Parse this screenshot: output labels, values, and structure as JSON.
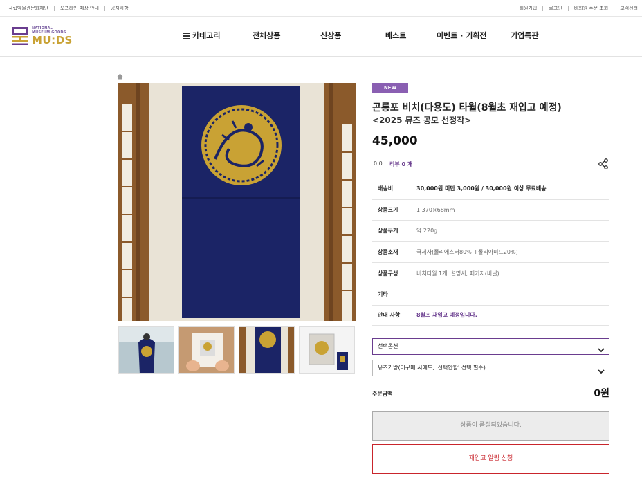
{
  "util_left": [
    "국립박물관문화재단",
    "오프라인 매장 안내",
    "공지사항"
  ],
  "util_right": [
    "회원가입",
    "로그인",
    "비회원 주문 조회",
    "고객센터"
  ],
  "logo": {
    "small_lines": [
      "NATIONAL",
      "MUSEUM GOODS"
    ],
    "big": "MU:DS"
  },
  "nav": [
    "카테고리",
    "전체상품",
    "신상품",
    "베스트",
    "이벤트 · 기획전",
    "기업특판"
  ],
  "product": {
    "badge": "NEW",
    "title": "곤룡포 비치(다용도) 타월(8월초 재입고 예정)",
    "subtitle": "<2025 뮤즈 공모 선정작>",
    "price": "45,000",
    "rating": "0.0",
    "review": "리뷰 0 개"
  },
  "info_rows": [
    {
      "key": "배송비",
      "value": "30,000원 미만 3,000원 / 30,000원 이상 무료배송",
      "style": "bold"
    },
    {
      "key": "상품크기",
      "value": "1,370×68mm",
      "style": ""
    },
    {
      "key": "상품무게",
      "value": "약 220g",
      "style": ""
    },
    {
      "key": "상품소재",
      "value": "극세사(폴리에스터80% +폴리아미드20%)",
      "style": ""
    },
    {
      "key": "상품구성",
      "value": "비치타월 1개, 설명서, 패키지(비닐)",
      "style": ""
    },
    {
      "key": "기타",
      "value": "",
      "style": ""
    },
    {
      "key": "안내 사항",
      "value": "8월초 재입고 예정입니다.",
      "style": "accent"
    }
  ],
  "select1": "선택옵션",
  "select2": "뮤즈가방(미구매 시에도, '선택안함' 선택 필수)",
  "total": {
    "label": "주문금액",
    "value": "0원"
  },
  "buttons": {
    "soldout": "상품이 품절되었습니다.",
    "restock": "재입고 알림 신청"
  },
  "colors": {
    "accent": "#6a3d8f",
    "badge": "#8a5fb2",
    "logo_gold": "#c9a234",
    "restock": "#c9252c"
  }
}
